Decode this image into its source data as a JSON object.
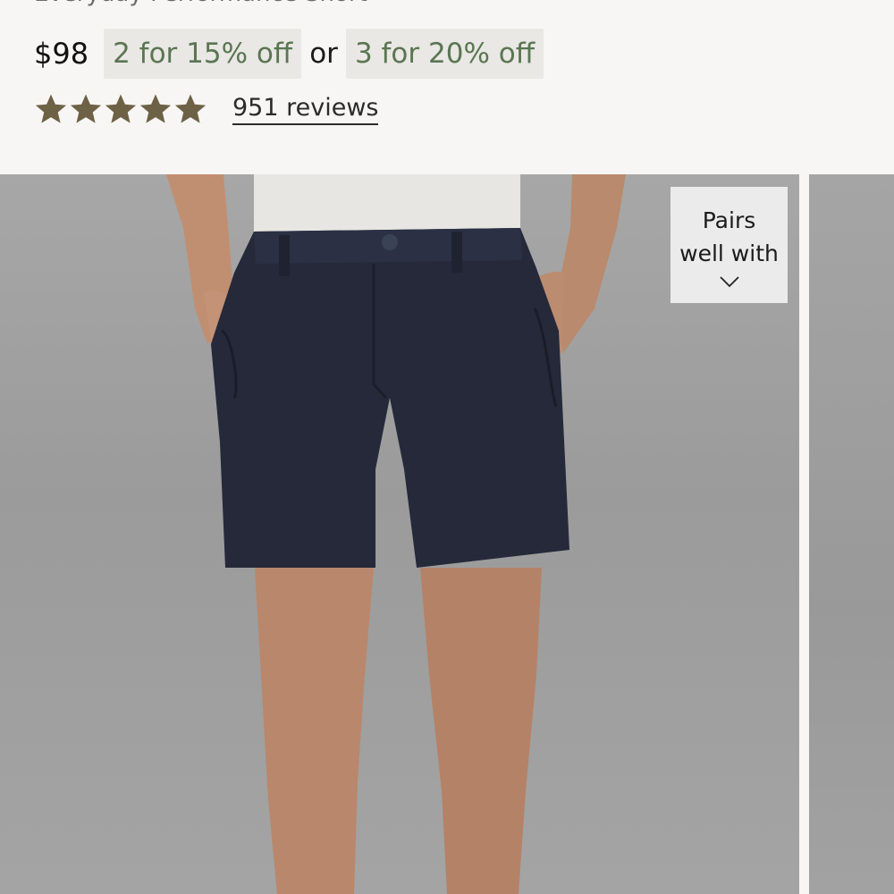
{
  "product": {
    "title_partial": "Everyday Performance Short",
    "price": "$98",
    "promos": [
      "2 for 15% off",
      "3 for 20% off"
    ],
    "promo_separator": "or",
    "rating": {
      "stars": 5,
      "reviews_label": "951 reviews"
    }
  },
  "gallery": {
    "pairs_button": {
      "label": "Pairs well with",
      "icon": "chevron-down-icon"
    },
    "images": [
      {
        "alt": "Model wearing navy chino shorts"
      },
      {
        "alt": "Next product image"
      }
    ]
  },
  "colors": {
    "promo_text": "#5b7553",
    "promo_bg": "#e9e8e4",
    "star": "#6d6146",
    "photo_bg": "#a2a2a2",
    "shorts": "#25293a"
  }
}
